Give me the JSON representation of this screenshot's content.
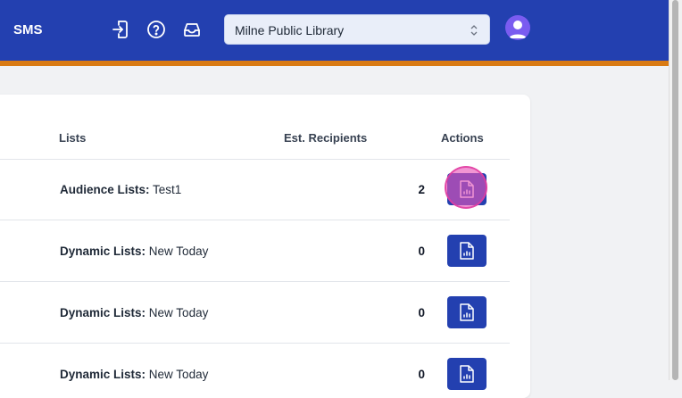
{
  "header": {
    "brand": "SMS",
    "icons": [
      "sign-in-icon",
      "help-icon",
      "inbox-icon"
    ],
    "library_select": {
      "value": "Milne Public Library"
    },
    "accent_color": "#2340b0",
    "border_color": "#d97a13"
  },
  "table": {
    "columns": {
      "lists": "Lists",
      "recipients": "Est. Recipients",
      "actions": "Actions"
    },
    "rows": [
      {
        "type": "Audience Lists:",
        "name": "Test1",
        "count": "2"
      },
      {
        "type": "Dynamic Lists:",
        "name": "New Today",
        "count": "0"
      },
      {
        "type": "Dynamic Lists:",
        "name": "New Today",
        "count": "0"
      },
      {
        "type": "Dynamic Lists:",
        "name": "New Today",
        "count": "0"
      }
    ],
    "action_icon": "report-document-icon"
  },
  "click_marker_color": "#e854b8"
}
